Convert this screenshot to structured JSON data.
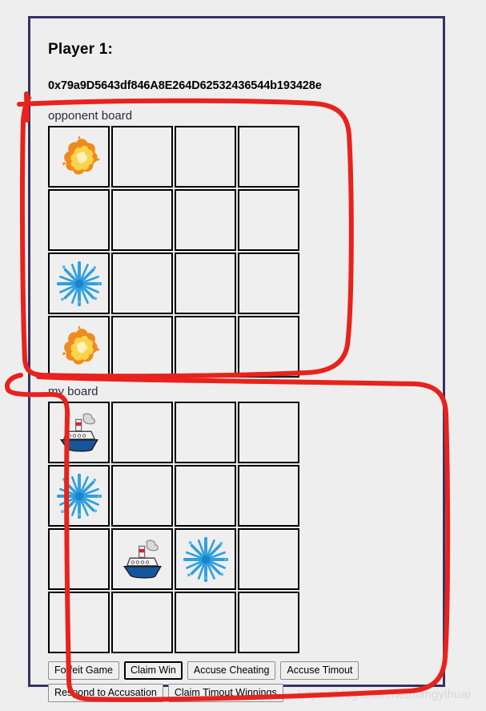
{
  "app": {
    "title": "Player 1:",
    "player_address": "0x79a9D5643df846A8E264D62532436544b193428e",
    "panel_border_color": "#333366",
    "page_background": "#eeeeee",
    "annotation_color": "#e8221c",
    "watermark": "https://blog.csdn.net/liangyihuai"
  },
  "opponent_board": {
    "label": "opponent board",
    "rows": 4,
    "cols": 4,
    "cells": [
      [
        {
          "state": "hit",
          "icon": "explosion-icon"
        },
        {
          "state": "empty",
          "icon": ""
        },
        {
          "state": "empty",
          "icon": ""
        },
        {
          "state": "empty",
          "icon": ""
        }
      ],
      [
        {
          "state": "empty",
          "icon": ""
        },
        {
          "state": "empty",
          "icon": ""
        },
        {
          "state": "empty",
          "icon": ""
        },
        {
          "state": "empty",
          "icon": ""
        }
      ],
      [
        {
          "state": "miss",
          "icon": "splash-icon"
        },
        {
          "state": "empty",
          "icon": ""
        },
        {
          "state": "empty",
          "icon": ""
        },
        {
          "state": "empty",
          "icon": ""
        }
      ],
      [
        {
          "state": "hit",
          "icon": "explosion-icon"
        },
        {
          "state": "empty",
          "icon": ""
        },
        {
          "state": "empty",
          "icon": ""
        },
        {
          "state": "empty",
          "icon": ""
        }
      ]
    ]
  },
  "my_board": {
    "label": "my board",
    "rows": 4,
    "cols": 4,
    "cells": [
      [
        {
          "state": "ship",
          "icon": "ship-icon"
        },
        {
          "state": "empty",
          "icon": ""
        },
        {
          "state": "empty",
          "icon": ""
        },
        {
          "state": "empty",
          "icon": ""
        }
      ],
      [
        {
          "state": "miss",
          "icon": "splash-icon"
        },
        {
          "state": "empty",
          "icon": ""
        },
        {
          "state": "empty",
          "icon": ""
        },
        {
          "state": "empty",
          "icon": ""
        }
      ],
      [
        {
          "state": "empty",
          "icon": ""
        },
        {
          "state": "ship",
          "icon": "ship-icon"
        },
        {
          "state": "miss",
          "icon": "splash-icon"
        },
        {
          "state": "empty",
          "icon": ""
        }
      ],
      [
        {
          "state": "empty",
          "icon": ""
        },
        {
          "state": "empty",
          "icon": ""
        },
        {
          "state": "empty",
          "icon": ""
        },
        {
          "state": "empty",
          "icon": ""
        }
      ]
    ]
  },
  "actions": [
    {
      "label": "Forfeit Game",
      "name": "forfeit-game-button",
      "focused": false
    },
    {
      "label": "Claim Win",
      "name": "claim-win-button",
      "focused": true
    },
    {
      "label": "Accuse Cheating",
      "name": "accuse-cheating-button",
      "focused": false
    },
    {
      "label": "Accuse Timout",
      "name": "accuse-timout-button",
      "focused": false
    },
    {
      "label": "Respond to Accusation",
      "name": "respond-to-accusation-button",
      "focused": false
    },
    {
      "label": "Claim Timout Winnings",
      "name": "claim-timout-winnings-button",
      "focused": false
    }
  ]
}
